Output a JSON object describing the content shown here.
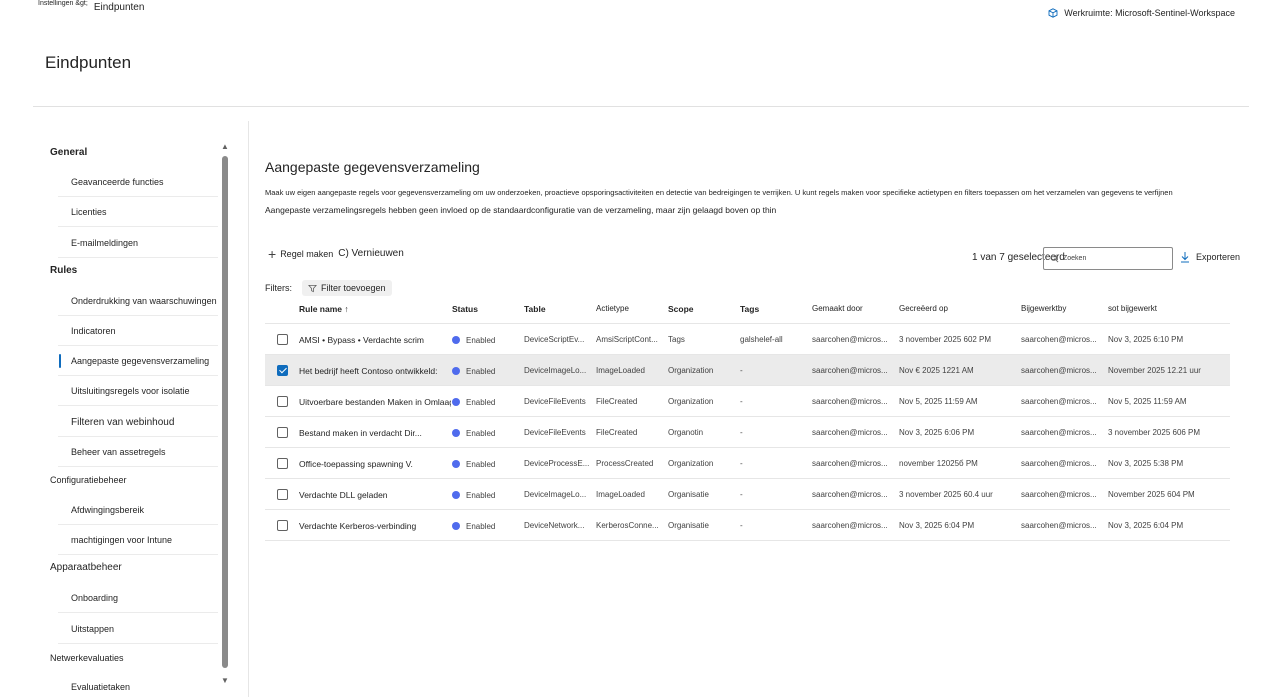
{
  "breadcrumb": {
    "parent": "Instellingen &gt;",
    "current": "Eindpunten"
  },
  "workspace": {
    "label": "Werkruimte: Microsoft-Sentinel-Workspace",
    "icon": "cube-icon"
  },
  "page_title": "Eindpunten",
  "sidebar": {
    "groups": [
      {
        "label": "General",
        "bold": true,
        "items": [
          "Geavanceerde functies",
          "Licenties",
          "E-mailmeldingen"
        ]
      },
      {
        "label": "Rules",
        "bold": true,
        "items": [
          "Onderdrukking van waarschuwingen",
          "Indicatoren",
          "Aangepaste gegevensverzameling",
          "Uitsluitingsregels voor isolatie",
          "Filteren van webinhoud",
          "Beheer van assetregels"
        ]
      },
      {
        "label": "Configuratiebeheer",
        "bold": false,
        "items": [
          "Afdwingingsbereik",
          "machtigingen voor Intune"
        ]
      },
      {
        "label": "Apparaatbeheer",
        "bold": false,
        "items": [
          "Onboarding",
          "Uitstappen"
        ]
      },
      {
        "label": "Netwerkevaluaties",
        "bold": false,
        "items": [
          "Evaluatietaken"
        ]
      }
    ],
    "active_item": "Aangepaste gegevensverzameling"
  },
  "main": {
    "section_title": "Aangepaste gegevensverzameling",
    "description_line1": "Maak uw eigen aangepaste regels voor gegevensverzameling om uw onderzoeken, proactieve opsporingsactiviteiten en detectie van bedreigingen te verrijken. U kunt regels maken voor specifieke actietypen en filters toepassen om het verzamelen van gegevens te verfijnen",
    "description_line2": "Aangepaste verzamelingsregels hebben geen invloed op de standaardconfiguratie van de verzameling, maar zijn gelaagd boven op thin",
    "toolbar": {
      "create_label": "Regel maken",
      "refresh_label": "C) Vernieuwen"
    },
    "selected_count": "1 van 7 geselecteerd",
    "search_placeholder": "Zoeken",
    "export_label": "Exporteren",
    "filters_label": "Filters:",
    "add_filter_label": "Filter toevoegen"
  },
  "table": {
    "columns": [
      "Rule name ↑",
      "Status",
      "Table",
      "Actietype",
      "Scope",
      "Tags",
      "Gemaakt door",
      "Gecreëerd op",
      "Bijgewerktby",
      "sot bijgewerkt"
    ],
    "rows": [
      {
        "checked": false,
        "name": "AMSI • Bypass • Verdachte scrim",
        "status": "Enabled",
        "table": "DeviceScriptEv...",
        "action": "AmsiScriptCont...",
        "scope": "Tags",
        "tags": "galshelef-all",
        "created_by": "saarcohen@micros...",
        "created_on": "3 november 2025 602 PM",
        "updated_by": "saarcohen@micros...",
        "updated_on": "Nov 3, 2025 6:10 PM"
      },
      {
        "checked": true,
        "name": "Het bedrijf heeft Contoso ontwikkeld:",
        "status": "Enabled",
        "table": "DeviceImageLo...",
        "action": "ImageLoaded",
        "scope": "Organization",
        "tags": "-",
        "created_by": "saarcohen@micros...",
        "created_on": "Nov € 2025 1221 AM",
        "updated_by": "saarcohen@micros...",
        "updated_on": "November 2025 12.21 uur"
      },
      {
        "checked": false,
        "name": "Uitvoerbare bestanden Maken in Omlaag:",
        "status": "Enabled",
        "table": "DeviceFileEvents",
        "action": "FileCreated",
        "scope": "Organization",
        "tags": "-",
        "created_by": "saarcohen@micros...",
        "created_on": "Nov 5, 2025 11:59 AM",
        "updated_by": "saarcohen@micros...",
        "updated_on": "Nov 5, 2025 11:59 AM"
      },
      {
        "checked": false,
        "name": "Bestand maken in verdacht     Dir...",
        "status": "Enabled",
        "table": "DeviceFileEvents",
        "action": "FileCreated",
        "scope": "Organotin",
        "tags": "-",
        "created_by": "saarcohen@micros...",
        "created_on": "Nov 3, 2025 6:06 PM",
        "updated_by": "saarcohen@micros...",
        "updated_on": "3 november 2025 606 PM"
      },
      {
        "checked": false,
        "name": "Office-toepassing spawning V.",
        "status": "Enabled",
        "table": "DeviceProcessE...",
        "action": "ProcessCreated",
        "scope": "Organization",
        "tags": "-",
        "created_by": "saarcohen@micros...",
        "created_on": "november 12025б PM",
        "updated_by": "saarcohen@micros...",
        "updated_on": "Nov 3, 2025 5:38 PM"
      },
      {
        "checked": false,
        "name": "Verdachte DLL geladen",
        "status": "Enabled",
        "table": "DeviceImageLo...",
        "action": "ImageLoaded",
        "scope": "Organisatie",
        "tags": "-",
        "created_by": "saarcohen@micros...",
        "created_on": "3 november 2025 60.4 uur",
        "updated_by": "saarcohen@micros...",
        "updated_on": "November 2025 604 PM"
      },
      {
        "checked": false,
        "name": "Verdachte Kerberos-verbinding",
        "status": "Enabled",
        "table": "DeviceNetwork...",
        "action": "KerberosConne...",
        "scope": "Organisatie",
        "tags": "-",
        "created_by": "saarcohen@micros...",
        "created_on": "Nov 3, 2025 6:04 PM",
        "updated_by": "saarcohen@micros...",
        "updated_on": "Nov 3, 2025 6:04 PM"
      }
    ]
  },
  "colors": {
    "accent": "#0f6cbd",
    "status_dot": "#4f6bed",
    "selected_row": "#ebebeb"
  }
}
